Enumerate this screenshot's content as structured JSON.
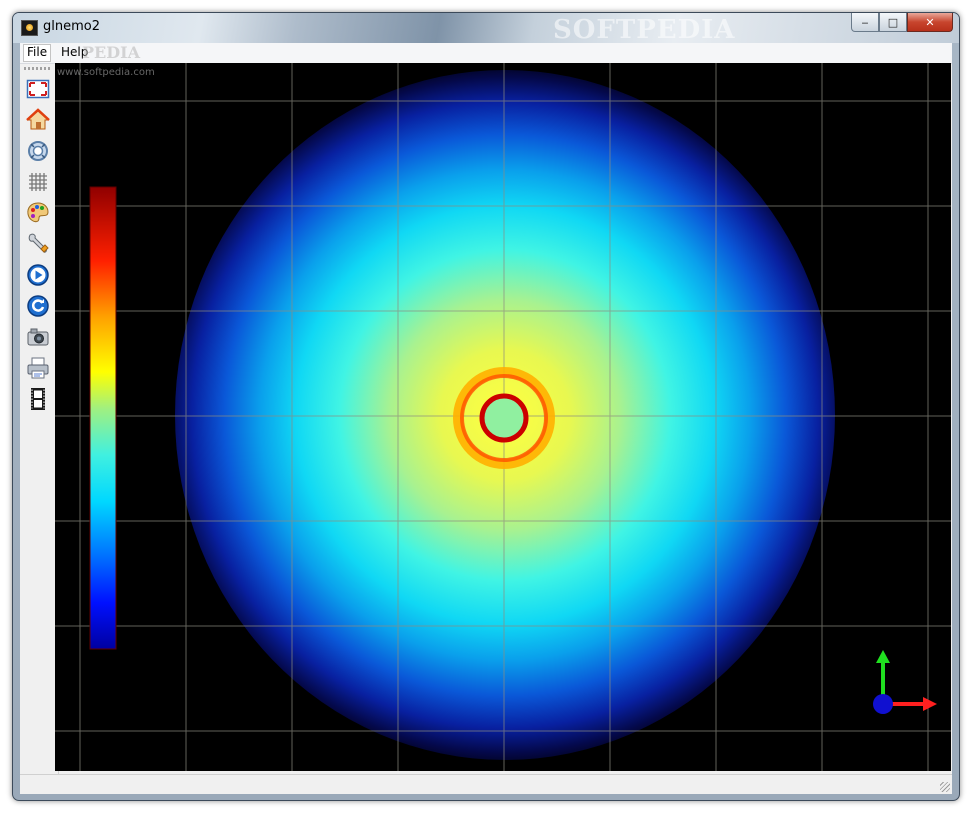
{
  "window": {
    "title": "glnemo2",
    "watermark": "SOFTPEDIA",
    "buttons": {
      "minimize": "‒",
      "maximize": "□",
      "close": "✕"
    }
  },
  "menubar": {
    "items": [
      {
        "label": "File"
      },
      {
        "label": "Help"
      }
    ],
    "watermark": "PEDIA"
  },
  "viewport": {
    "url_watermark": "www.softpedia.com"
  },
  "toolbar": {
    "tools": [
      {
        "icon": "fullscreen-icon"
      },
      {
        "icon": "home-icon"
      },
      {
        "icon": "zoom-fit-icon"
      },
      {
        "icon": "grid-icon"
      },
      {
        "icon": "palette-icon"
      },
      {
        "icon": "wrench-icon"
      },
      {
        "icon": "play-icon"
      },
      {
        "icon": "reload-icon"
      },
      {
        "icon": "camera-icon"
      },
      {
        "icon": "printer-icon"
      },
      {
        "icon": "film-icon"
      }
    ]
  },
  "colors": {
    "background": "#000000",
    "grid": "#8c8c80",
    "axis_x": "#ff2020",
    "axis_y": "#20e020",
    "axis_z": "#1010d0"
  }
}
